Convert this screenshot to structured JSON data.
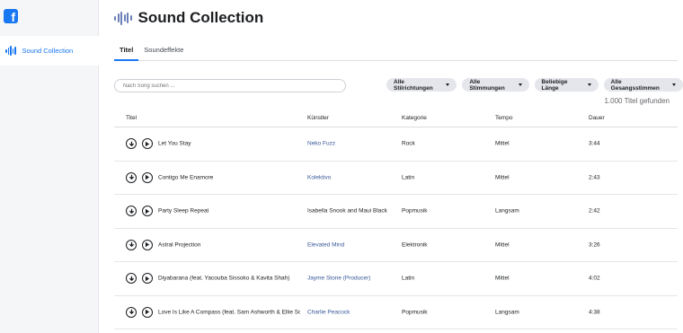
{
  "sidebar": {
    "logo": "f",
    "items": [
      {
        "label": "Sound Collection"
      }
    ]
  },
  "header": {
    "title": "Sound Collection"
  },
  "tabs": [
    {
      "label": "Titel",
      "active": true
    },
    {
      "label": "Soundeffekte",
      "active": false
    }
  ],
  "search": {
    "placeholder": "Nach Song suchen ..."
  },
  "filters": [
    {
      "label": "Alle Stilrichtungen"
    },
    {
      "label": "Alle Stimmungen"
    },
    {
      "label": "Beliebige Länge"
    },
    {
      "label": "Alle Gesangsstimmen"
    }
  ],
  "result_count": "1.000 Titel gefunden",
  "table": {
    "columns": [
      "Titel",
      "Künstler",
      "Kategorie",
      "Tempo",
      "Dauer"
    ],
    "rows": [
      {
        "title": "Let You Stay",
        "artist": "Neko Fuzz",
        "artist_link": true,
        "category": "Rock",
        "tempo": "Mittel",
        "duration": "3:44"
      },
      {
        "title": "Contigo Me Enamore",
        "artist": "Kolektivo",
        "artist_link": true,
        "category": "Latin",
        "tempo": "Mittel",
        "duration": "2:43"
      },
      {
        "title": "Party Sleep Repeat",
        "artist": "Isabella Snook and Maui Black",
        "artist_link": false,
        "category": "Popmusik",
        "tempo": "Langsam",
        "duration": "2:42"
      },
      {
        "title": "Astral Projection",
        "artist": "Elevated Mind",
        "artist_link": true,
        "category": "Elektronik",
        "tempo": "Mittel",
        "duration": "3:26"
      },
      {
        "title": "Diyabarana (feat. Yacouba Sissoko & Kavita Shah)",
        "artist": "Jayme Stone (Producer)",
        "artist_link": true,
        "category": "Latin",
        "tempo": "Mittel",
        "duration": "4:02"
      },
      {
        "title": "Love Is Like A Compass (feat. Sam Ashworth & Ellie Scl",
        "artist": "Charlie Peacock",
        "artist_link": true,
        "category": "Popmusik",
        "tempo": "Langsam",
        "duration": "4:38"
      }
    ]
  },
  "colors": {
    "accent": "#1877f2",
    "link": "#385898"
  },
  "icons": {
    "download": "download-icon",
    "play": "play-icon",
    "wave": "soundwave-icon"
  }
}
